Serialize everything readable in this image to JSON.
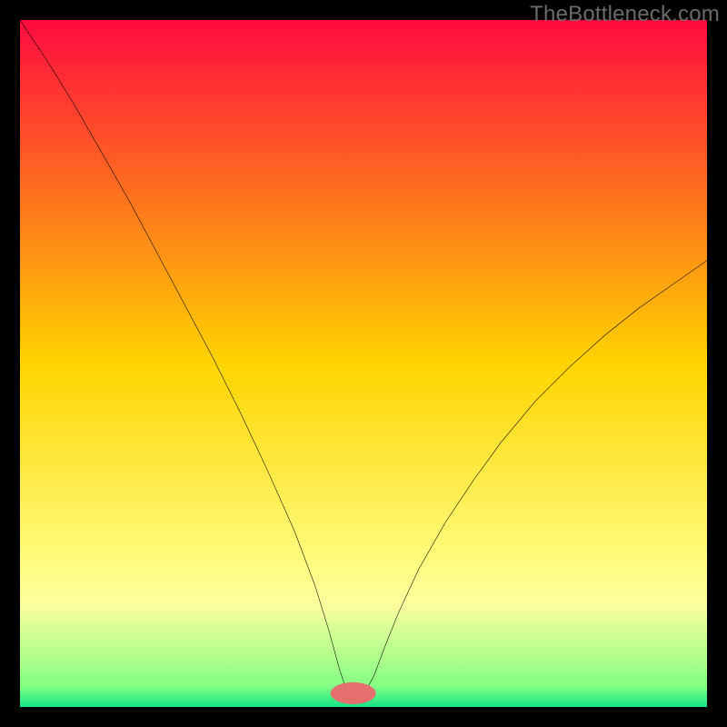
{
  "watermark": "TheBottleneck.com",
  "chart_data": {
    "type": "line",
    "title": "",
    "xlabel": "",
    "ylabel": "",
    "xlim": [
      0,
      100
    ],
    "ylim": [
      0,
      100
    ],
    "grid": false,
    "background_gradient": {
      "stops": [
        {
          "offset": 0.0,
          "color": "#ff0b3e"
        },
        {
          "offset": 0.5,
          "color": "#ffd400"
        },
        {
          "offset": 0.78,
          "color": "#fffb7a"
        },
        {
          "offset": 0.85,
          "color": "#fdff9e"
        },
        {
          "offset": 0.97,
          "color": "#84ff83"
        },
        {
          "offset": 1.0,
          "color": "#13e487"
        }
      ]
    },
    "marker": {
      "x": 48.5,
      "y": 2.0,
      "color": "#e46f6e",
      "rx": 3.3,
      "ry": 1.6
    },
    "series": [
      {
        "name": "curve",
        "color": "#000000",
        "width": 0.55,
        "points": [
          {
            "x": 0.0,
            "y": 100.0
          },
          {
            "x": 4.0,
            "y": 94.0
          },
          {
            "x": 8.0,
            "y": 87.5
          },
          {
            "x": 12.0,
            "y": 80.5
          },
          {
            "x": 16.0,
            "y": 73.5
          },
          {
            "x": 20.0,
            "y": 66.0
          },
          {
            "x": 24.0,
            "y": 58.5
          },
          {
            "x": 28.0,
            "y": 51.0
          },
          {
            "x": 32.0,
            "y": 43.0
          },
          {
            "x": 36.0,
            "y": 34.5
          },
          {
            "x": 40.0,
            "y": 25.5
          },
          {
            "x": 43.0,
            "y": 17.5
          },
          {
            "x": 45.0,
            "y": 11.0
          },
          {
            "x": 46.5,
            "y": 5.5
          },
          {
            "x": 47.5,
            "y": 2.5
          },
          {
            "x": 48.5,
            "y": 1.8
          },
          {
            "x": 49.5,
            "y": 1.8
          },
          {
            "x": 50.3,
            "y": 2.3
          },
          {
            "x": 51.5,
            "y": 4.5
          },
          {
            "x": 53.0,
            "y": 8.5
          },
          {
            "x": 55.0,
            "y": 13.5
          },
          {
            "x": 58.0,
            "y": 20.0
          },
          {
            "x": 62.0,
            "y": 27.0
          },
          {
            "x": 66.0,
            "y": 33.0
          },
          {
            "x": 70.0,
            "y": 38.5
          },
          {
            "x": 75.0,
            "y": 44.5
          },
          {
            "x": 80.0,
            "y": 49.5
          },
          {
            "x": 85.0,
            "y": 54.0
          },
          {
            "x": 90.0,
            "y": 58.0
          },
          {
            "x": 95.0,
            "y": 61.5
          },
          {
            "x": 100.0,
            "y": 65.0
          }
        ]
      }
    ]
  }
}
